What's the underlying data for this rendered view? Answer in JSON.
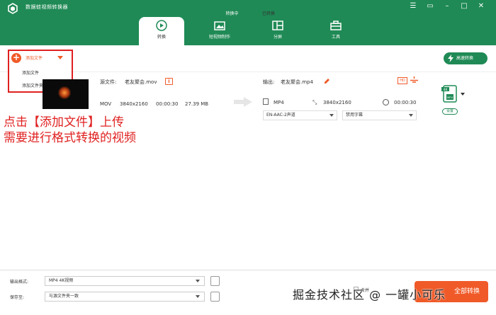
{
  "app": {
    "title": "数据蛙视频转换器",
    "accent": "#1f8a55",
    "orange": "#f05a28",
    "window_controls": [
      "menu-icon",
      "chat-icon",
      "minimize-icon",
      "maximize-icon",
      "close-icon"
    ]
  },
  "tabs": [
    {
      "label": "转换",
      "icon": "convert-icon",
      "active": true
    },
    {
      "label": "短视频制作",
      "icon": "video-make-icon",
      "active": false
    },
    {
      "label": "分屏",
      "icon": "split-screen-icon",
      "active": false
    },
    {
      "label": "工具",
      "icon": "toolbox-icon",
      "active": false
    }
  ],
  "toolbar": {
    "converting": "转换中",
    "converted": "已转换",
    "fast_convert": "高速转换",
    "add_file": "添加文件",
    "menu_add_file": "添加文件",
    "menu_add_folder": "添加文件夹"
  },
  "source": {
    "label": "源文件:",
    "filename": "老友聚会.mov",
    "format": "MOV",
    "resolution": "3840x2160",
    "duration": "00:00:30",
    "size": "27.39 MB"
  },
  "output": {
    "label": "输出:",
    "filename": "老友聚会.mp4",
    "format": "MP4",
    "resolution": "3840x2160",
    "duration": "00:00:30",
    "audio": "EN-AAC-2声道",
    "subtitle": "禁用字幕",
    "badge_top": "4K",
    "badge_bottom": "MP4",
    "setting": "设置"
  },
  "hint": {
    "line1": "点击【添加文件】上传",
    "line2": "需要进行格式转换的视频"
  },
  "footer": {
    "format_label": "输出格式:",
    "format_value": "MP4 4K视频",
    "save_label": "保存至:",
    "save_value": "与源文件夹一致",
    "merge_label": "合并",
    "convert_label": "全部转换",
    "watermark": "掘金技术社区 @ 一罐小可乐"
  }
}
